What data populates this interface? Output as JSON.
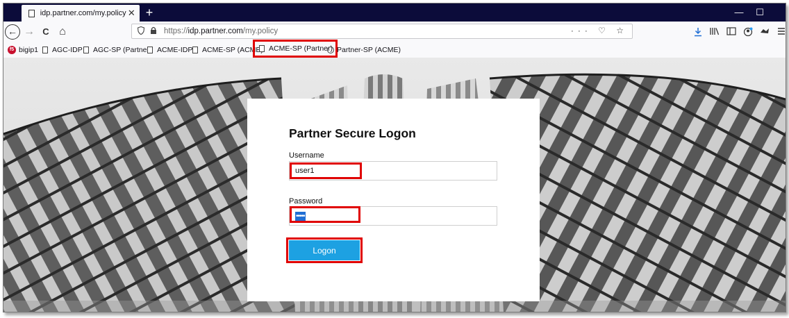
{
  "browser": {
    "tab": {
      "title": "idp.partner.com/my.policy",
      "close": "✕"
    },
    "new_tab": "+",
    "window": {
      "minimize": "—",
      "maximize": "☐",
      "close": "✕"
    },
    "nav": {
      "back": "←",
      "forward": "→",
      "reload": "C",
      "home": "⌂"
    },
    "url": {
      "scheme": "https://",
      "domain": "idp.partner.com",
      "path": "/my.policy",
      "actions": "··· ♡ ☆"
    },
    "toolbar_icons": [
      "download-icon",
      "library-icon",
      "sidebar-icon",
      "account-icon",
      "extension-icon",
      "menu-icon"
    ]
  },
  "bookmarks": [
    {
      "label": "bigip1",
      "icon": "f5-icon"
    },
    {
      "label": "AGC-IDP",
      "icon": "page-icon"
    },
    {
      "label": "AGC-SP (Partner)",
      "icon": "page-icon"
    },
    {
      "label": "ACME-IDP",
      "icon": "page-icon"
    },
    {
      "label": "ACME-SP (ACME)",
      "icon": "page-icon"
    },
    {
      "label": "ACME-SP (Partner)",
      "icon": "page-icon",
      "highlighted": true
    },
    {
      "label": "Partner-SP (ACME)",
      "icon": "globe-icon"
    }
  ],
  "login": {
    "title": "Partner Secure Logon",
    "username_label": "Username",
    "username_value": "user1",
    "password_label": "Password",
    "password_value": "•••••",
    "submit_label": "Logon"
  },
  "highlight_color": "#e00000",
  "button_color": "#1da1e2"
}
